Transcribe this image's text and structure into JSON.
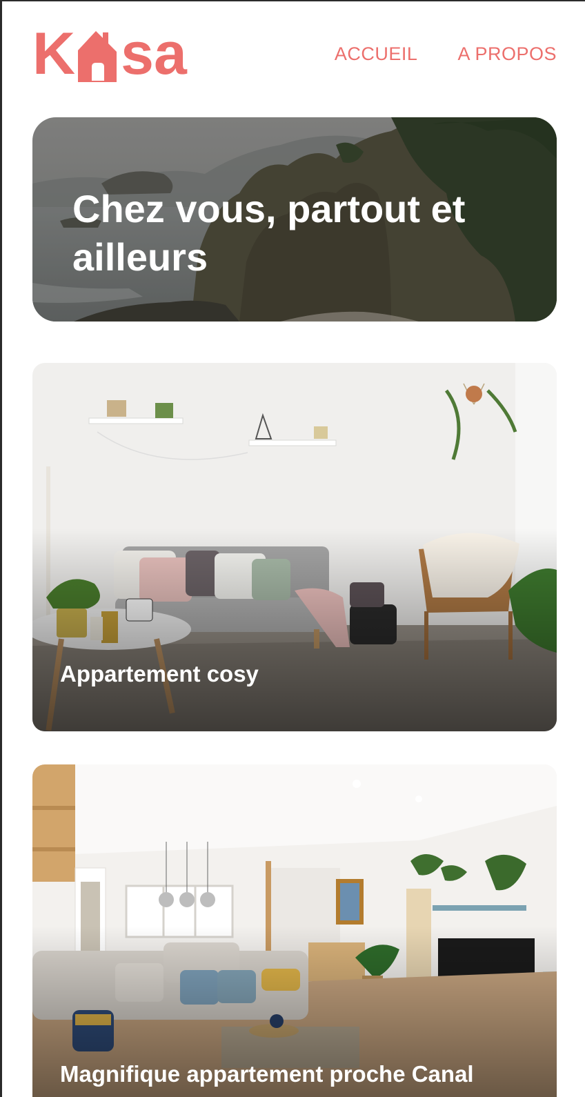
{
  "brand": {
    "logo_left": "K",
    "logo_right": "sa",
    "logo_icon": "house-icon",
    "accent_color": "#ec6f6c"
  },
  "nav": {
    "items": [
      {
        "label": "ACCUEIL"
      },
      {
        "label": "A PROPOS"
      }
    ]
  },
  "banner": {
    "title": "Chez vous, partout et ailleurs",
    "image": "coastal-cliffs-photo"
  },
  "listings": [
    {
      "title": "Appartement cosy",
      "image": "cosy-living-room-photo"
    },
    {
      "title": "Magnifique appartement proche Canal",
      "image": "bright-living-room-photo"
    }
  ]
}
